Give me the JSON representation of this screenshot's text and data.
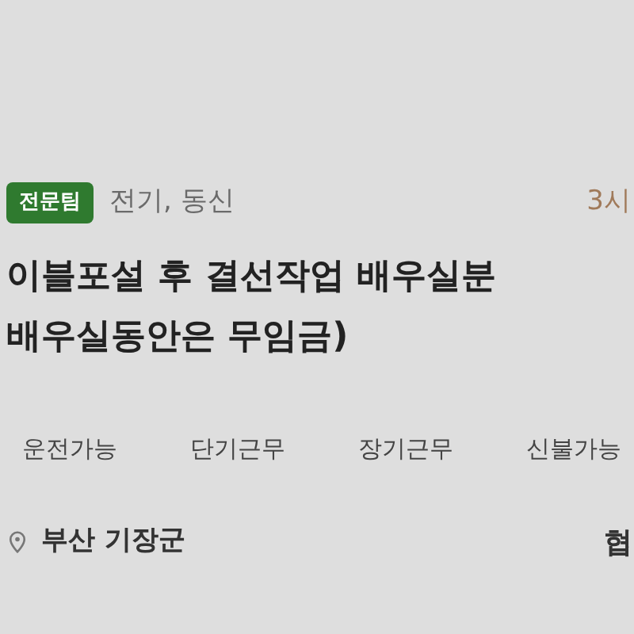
{
  "badge": "전문팀",
  "category": "전기, 동신",
  "time": "3시",
  "title_lines": [
    "이블포설 후 결선작업 배우실분",
    "배우실동안은 무임금)"
  ],
  "tags": [
    "운전가능",
    "단기근무",
    "장기근무",
    "신불가능"
  ],
  "location": "부산 기장군",
  "right_text": "협"
}
